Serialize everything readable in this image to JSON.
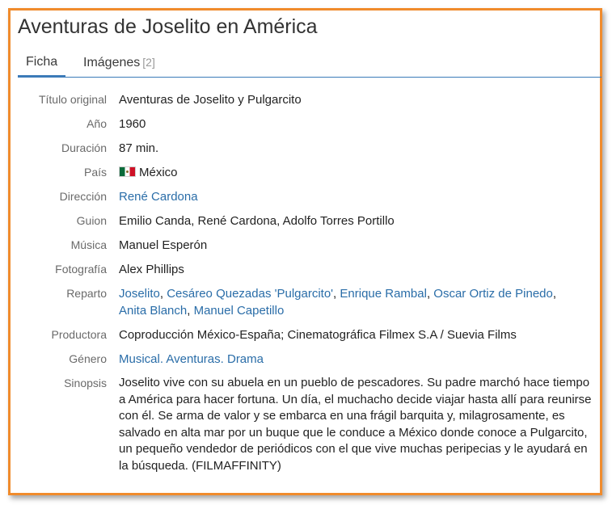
{
  "title": "Aventuras de Joselito en América",
  "tabs": [
    {
      "label": "Ficha",
      "count": ""
    },
    {
      "label": "Imágenes",
      "count": "[2]"
    }
  ],
  "fields": {
    "titulo_original": {
      "label": "Título original",
      "value": "Aventuras de Joselito y Pulgarcito"
    },
    "ano": {
      "label": "Año",
      "value": "1960"
    },
    "duracion": {
      "label": "Duración",
      "value": "87 min."
    },
    "pais": {
      "label": "País",
      "value": "México",
      "flag_icon": "mexico-flag-icon"
    },
    "direccion": {
      "label": "Dirección",
      "value": "René Cardona"
    },
    "guion": {
      "label": "Guion",
      "value": "Emilio Canda, René Cardona, Adolfo Torres Portillo"
    },
    "musica": {
      "label": "Música",
      "value": "Manuel Esperón"
    },
    "fotografia": {
      "label": "Fotografía",
      "value": "Alex Phillips"
    },
    "reparto": {
      "label": "Reparto",
      "cast": [
        "Joselito",
        "Cesáreo Quezadas 'Pulgarcito'",
        "Enrique Rambal",
        "Oscar Ortiz de Pinedo",
        "Anita Blanch",
        "Manuel Capetillo"
      ],
      "separator": ", "
    },
    "productora": {
      "label": "Productora",
      "value": "Coproducción México-España; Cinematográfica Filmex S.A / Suevia Films"
    },
    "genero": {
      "label": "Género",
      "genres": [
        "Musical",
        "Aventuras",
        "Drama"
      ],
      "separator": ". "
    },
    "sinopsis": {
      "label": "Sinopsis",
      "value": "Joselito vive con su abuela en un pueblo de pescadores. Su padre marchó hace tiempo a América para hacer fortuna. Un día, el muchacho decide viajar hasta allí para reunirse con él. Se arma de valor y se embarca en una frágil barquita y, milagrosamente, es salvado en alta mar por un buque que le conduce a México donde conoce a Pulgarcito, un pequeño vendedor de periódicos con el que vive muchas peripecias y le ayudará en la búsqueda. (FILMAFFINITY)"
    }
  },
  "colors": {
    "frame_border": "#f08b2c",
    "link": "#2a6da8",
    "tab_underline": "#3b7ab8"
  }
}
